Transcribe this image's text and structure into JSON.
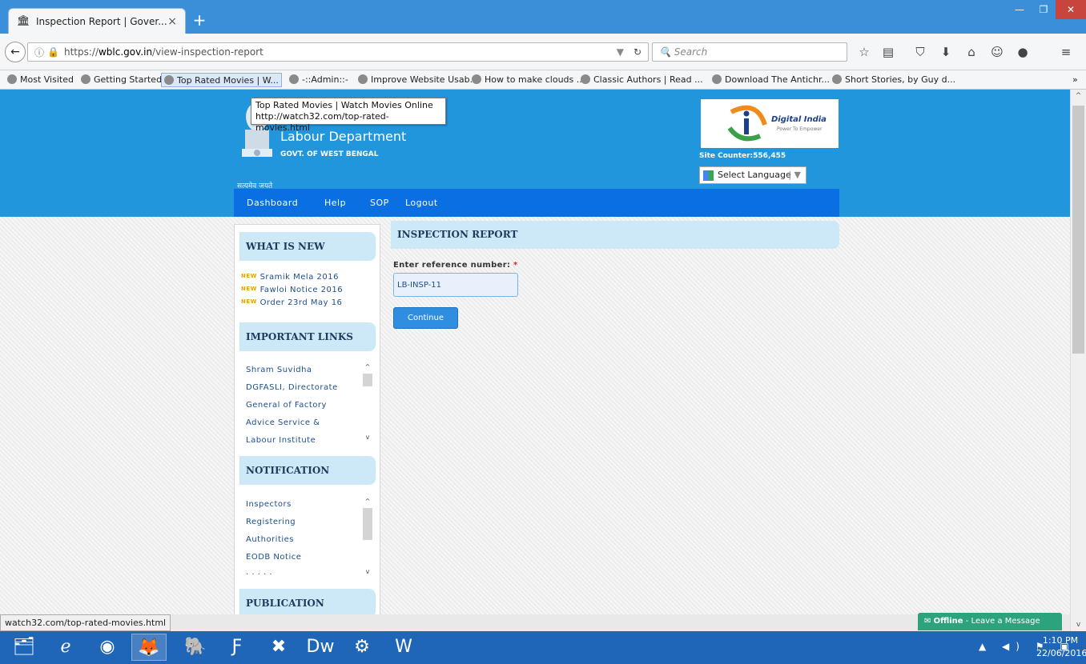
{
  "browser": {
    "tab_title": "Inspection Report | Gover...",
    "tab_close": "×",
    "new_tab": "+",
    "url_prefix": "https://",
    "url_domain": "wblc.gov.in",
    "url_path": "/view-inspection-report",
    "search_placeholder": "Search",
    "bookmarks": [
      "Most Visited",
      "Getting Started",
      "Top Rated Movies | W...",
      "-::Admin::-",
      "Improve Website Usab...",
      "How to make clouds ...",
      "Classic Authors | Read ...",
      "Download The Antichr...",
      "Short Stories, by Guy d..."
    ],
    "bookmarks_more": "»",
    "tooltip_line1": "Top Rated Movies | Watch Movies Online",
    "tooltip_line2": "http://watch32.com/top-rated-movies.html",
    "status_url": "watch32.com/top-rated-movies.html"
  },
  "header": {
    "emblem_caption": "सत्यमेव जयते",
    "dept_title": "Labour Department",
    "dept_sub": "GOVT. OF WEST BENGAL",
    "digital_india": "Digital India",
    "digital_india_tag": "Power To Empower",
    "site_counter": "Site Counter:556,455",
    "language_select": "Select Language"
  },
  "menu": [
    "Dashboard",
    "Help",
    "SOP",
    "Logout"
  ],
  "sidebar": {
    "whats_new_title": "WHAT IS NEW",
    "new_badge": "NEW",
    "news": [
      "Sramik Mela 2016",
      "Fawloi Notice 2016",
      "Order 23rd May 16"
    ],
    "important_links_title": "IMPORTANT LINKS",
    "important_links": [
      "Shram Suvidha",
      "DGFASLI, Directorate",
      "General of Factory",
      "Advice Service &",
      "Labour Institute"
    ],
    "notification_title": "NOTIFICATION",
    "notifications": [
      "Inspectors",
      "Registering",
      "Authorities",
      "EODB Notice",
      "· · · · ·"
    ],
    "publication_title": "PUBLICATION"
  },
  "main": {
    "title": "INSPECTION REPORT",
    "ref_label": "Enter reference number:",
    "required_mark": "*",
    "ref_value": "LB-INSP-11",
    "continue_label": "Continue"
  },
  "chat": {
    "status": "Offline",
    "action": "Leave a Message"
  },
  "taskbar": {
    "time": "1:10 PM",
    "date": "22/06/2016"
  },
  "colors": {
    "header_blue": "#2196dd",
    "menu_blue": "#0a6fe3",
    "section_head_bg": "#cde9f8",
    "button_blue": "#2f8ee0",
    "chat_green": "#2ca37d",
    "taskbar_blue": "#1f66b8"
  }
}
